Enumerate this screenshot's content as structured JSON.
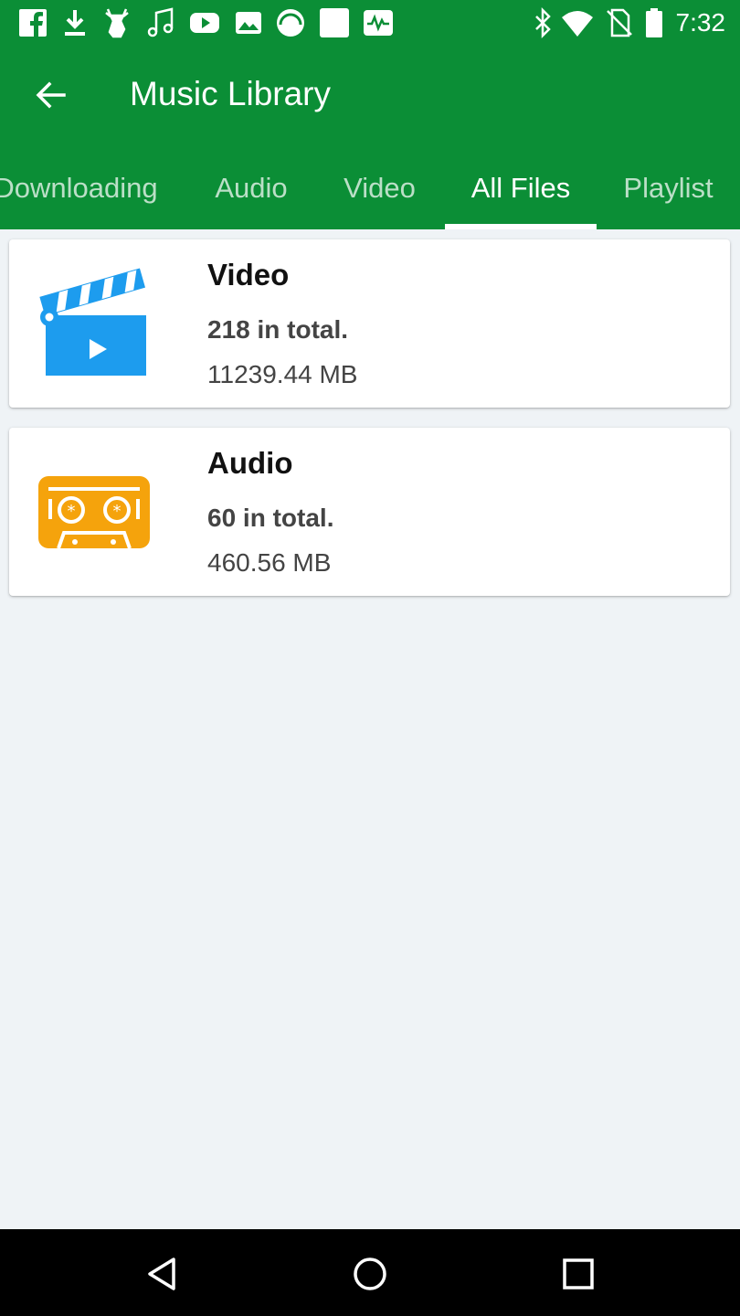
{
  "status_bar": {
    "time": "7:32",
    "left_icons": [
      "facebook-icon",
      "download-icon",
      "deer-app-icon",
      "music-note-icon",
      "youtube-icon",
      "image-icon",
      "headset-app-icon",
      "square-app-icon",
      "activity-icon"
    ],
    "right_icons": [
      "bluetooth-icon",
      "wifi-icon",
      "no-sim-icon",
      "battery-icon"
    ]
  },
  "app_bar": {
    "title": "Music Library",
    "back_icon": "arrow-left-icon",
    "tabs": [
      {
        "label": "Downloading",
        "active": false
      },
      {
        "label": "Audio",
        "active": false
      },
      {
        "label": "Video",
        "active": false
      },
      {
        "label": "All Files",
        "active": true
      },
      {
        "label": "Playlist",
        "active": false
      }
    ]
  },
  "categories": [
    {
      "name": "Video",
      "count": "218 in total.",
      "size": "11239.44 MB",
      "icon": "clapperboard-icon",
      "color": "#1d9cee"
    },
    {
      "name": "Audio",
      "count": "60 in total.",
      "size": "460.56 MB",
      "icon": "cassette-icon",
      "color": "#f5a30c"
    }
  ],
  "nav_bar": {
    "buttons": [
      "back-triangle-icon",
      "home-circle-icon",
      "recents-square-icon"
    ]
  },
  "colors": {
    "primary": "#0b8e36",
    "background": "#eff3f6",
    "video_icon": "#1d9cee",
    "audio_icon": "#f5a30c"
  }
}
